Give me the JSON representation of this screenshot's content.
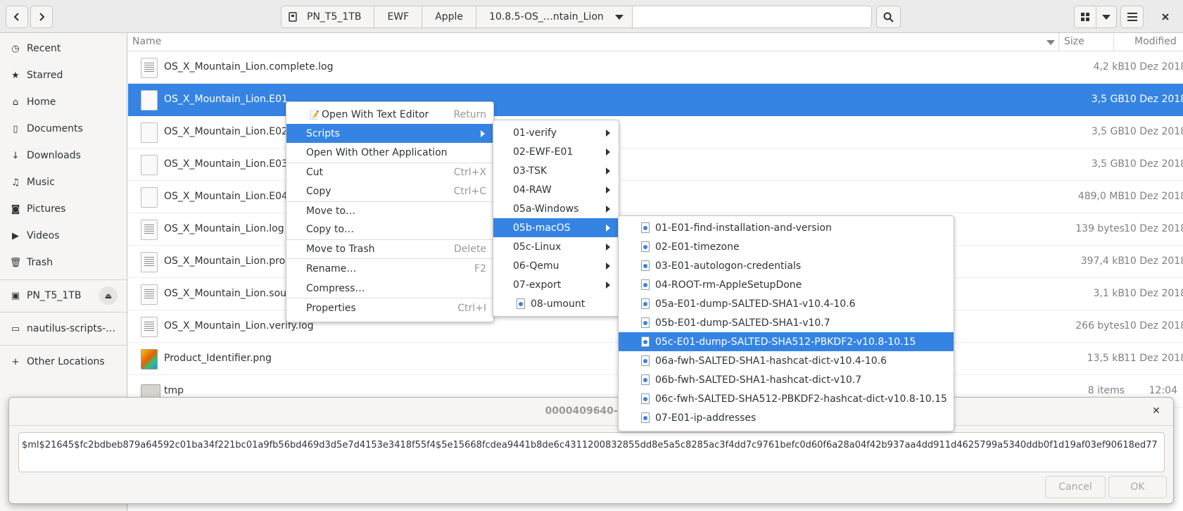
{
  "headerbar": {
    "back_icon": "chevron-left-icon",
    "forward_icon": "chevron-right-icon",
    "breadcrumbs": [
      "PN_T5_1TB",
      "EWF",
      "Apple",
      "10.8.5-OS_…ntain_Lion"
    ],
    "search_icon": "search-icon",
    "view_icon": "grid-view-icon",
    "menu_icon": "hamburger-icon",
    "close_icon": "close-icon"
  },
  "sidebar": {
    "items": [
      {
        "label": "Recent",
        "icon": "clock-icon"
      },
      {
        "label": "Starred",
        "icon": "star-icon"
      },
      {
        "label": "Home",
        "icon": "home-icon"
      },
      {
        "label": "Documents",
        "icon": "document-icon"
      },
      {
        "label": "Downloads",
        "icon": "download-icon"
      },
      {
        "label": "Music",
        "icon": "music-icon"
      },
      {
        "label": "Pictures",
        "icon": "camera-icon"
      },
      {
        "label": "Videos",
        "icon": "video-icon"
      },
      {
        "label": "Trash",
        "icon": "trash-icon"
      }
    ],
    "drive": {
      "label": "PN_T5_1TB",
      "icon": "drive-icon"
    },
    "bookmark": {
      "label": "nautilus-scripts-…",
      "icon": "folder-icon"
    },
    "other": {
      "label": "Other Locations",
      "icon": "plus-icon"
    }
  },
  "filelist": {
    "columns": {
      "name": "Name",
      "size": "Size",
      "modified": "Modified"
    },
    "rows": [
      {
        "name": "OS_X_Mountain_Lion.complete.log",
        "size": "4,2 kB",
        "modified": "10 Dez 2018"
      },
      {
        "name": "OS_X_Mountain_Lion.E01",
        "size": "3,5 GB",
        "modified": "10 Dez 2018"
      },
      {
        "name": "OS_X_Mountain_Lion.E02",
        "size": "3,5 GB",
        "modified": "10 Dez 2018"
      },
      {
        "name": "OS_X_Mountain_Lion.E03",
        "size": "3,5 GB",
        "modified": "10 Dez 2018"
      },
      {
        "name": "OS_X_Mountain_Lion.E04",
        "size": "489,0 MB",
        "modified": "10 Dez 2018"
      },
      {
        "name": "OS_X_Mountain_Lion.log",
        "size": "139 bytes",
        "modified": "10 Dez 2018"
      },
      {
        "name": "OS_X_Mountain_Lion.proce",
        "size": "397,4 kB",
        "modified": "10 Dez 2018"
      },
      {
        "name": "OS_X_Mountain_Lion.sourc",
        "size": "3,1 kB",
        "modified": "10 Dez 2018"
      },
      {
        "name": "OS_X_Mountain_Lion.verify.log",
        "size": "266 bytes",
        "modified": "10 Dez 2018"
      },
      {
        "name": "Product_Identifier.png",
        "size": "13,5 kB",
        "modified": "11 Dez 2018"
      },
      {
        "name": "tmp",
        "size": "8 items",
        "modified": "12:04"
      }
    ]
  },
  "context_menu": {
    "items": [
      {
        "label": "Open With Text Editor",
        "accel": "Return"
      },
      {
        "label": "Scripts",
        "accel": ""
      },
      {
        "label": "Open With Other Application",
        "accel": ""
      },
      {
        "label": "Cut",
        "accel": "Ctrl+X"
      },
      {
        "label": "Copy",
        "accel": "Ctrl+C"
      },
      {
        "label": "Move to…",
        "accel": ""
      },
      {
        "label": "Copy to…",
        "accel": ""
      },
      {
        "label": "Move to Trash",
        "accel": "Delete"
      },
      {
        "label": "Rename…",
        "accel": "F2"
      },
      {
        "label": "Compress…",
        "accel": ""
      },
      {
        "label": "Properties",
        "accel": "Ctrl+I"
      }
    ]
  },
  "scripts_menu": {
    "items": [
      "01-verify",
      "02-EWF-E01",
      "03-TSK",
      "04-RAW",
      "05a-Windows",
      "05b-macOS",
      "05c-Linux",
      "06-Qemu",
      "07-export",
      "08-umount"
    ]
  },
  "macos_menu": {
    "items": [
      "01-E01-find-installation-and-version",
      "02-E01-timezone",
      "03-E01-autologon-credentials",
      "04-ROOT-rm-AppleSetupDone",
      "05a-E01-dump-SALTED-SHA1-v10.4-10.6",
      "05b-E01-dump-SALTED-SHA1-v10.7",
      "05c-E01-dump-SALTED-SHA512-PBKDF2-v10.8-10.15",
      "06a-fwh-SALTED-SHA1-hashcat-dict-v10.4-10.6",
      "06b-fwh-SALTED-SHA1-hashcat-dict-v10.7",
      "06c-fwh-SALTED-SHA512-PBKDF2-hashcat-dict-v10.8-10.15",
      "07-E01-ip-addresses"
    ]
  },
  "dialog": {
    "title": "0000409640-has",
    "value": "$ml$21645$fc2bdbeb879a64592c01ba34f221bc01a9fb56bd469d3d5e7d4153e3418f55f4$5e15668fcdea9441b8de6c4311200832855dd8e5a5c8285ac3f4dd7c9761befc0d60f6a28a04f42b937aa4dd911d4625799a5340ddb0f1d19af03ef90618ed77",
    "cancel": "Cancel",
    "ok": "OK"
  }
}
